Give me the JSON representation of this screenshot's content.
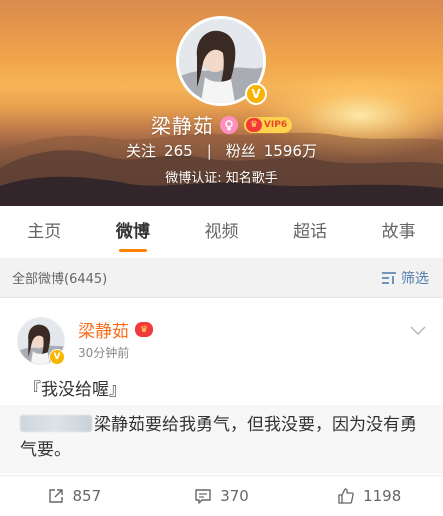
{
  "profile": {
    "name": "梁静茹",
    "vip_text": "VIP6",
    "follow_label": "关注",
    "follow_count": "265",
    "stats_separator": "|",
    "fans_label": "粉丝",
    "fans_count": "1596万",
    "certification": "微博认证: 知名歌手"
  },
  "tabs": [
    {
      "label": "主页"
    },
    {
      "label": "微博"
    },
    {
      "label": "视频"
    },
    {
      "label": "超话"
    },
    {
      "label": "故事"
    }
  ],
  "active_tab": "微博",
  "count_bar": {
    "label": "全部微博(6445)",
    "filter_label": "筛选"
  },
  "post": {
    "author": "梁静茹",
    "time": "30分钟前",
    "text": "『我没给喔』",
    "quote_text": "梁静茹要给我勇气，但我没要，因为没有勇气要。",
    "reposts": "857",
    "comments": "370",
    "likes": "1198"
  },
  "colors": {
    "accent": "#ff8200",
    "author_name": "#f86c1a",
    "link_blue": "#507daf",
    "verify_gold": "#f7b500"
  },
  "icons": {
    "verify": "verified-badge-icon",
    "gender": "female-icon",
    "vip": "vip-crown-icon",
    "filter": "filter-icon",
    "more": "chevron-down-icon",
    "repost": "repost-icon",
    "comment": "comment-icon",
    "like": "thumbs-up-icon"
  }
}
